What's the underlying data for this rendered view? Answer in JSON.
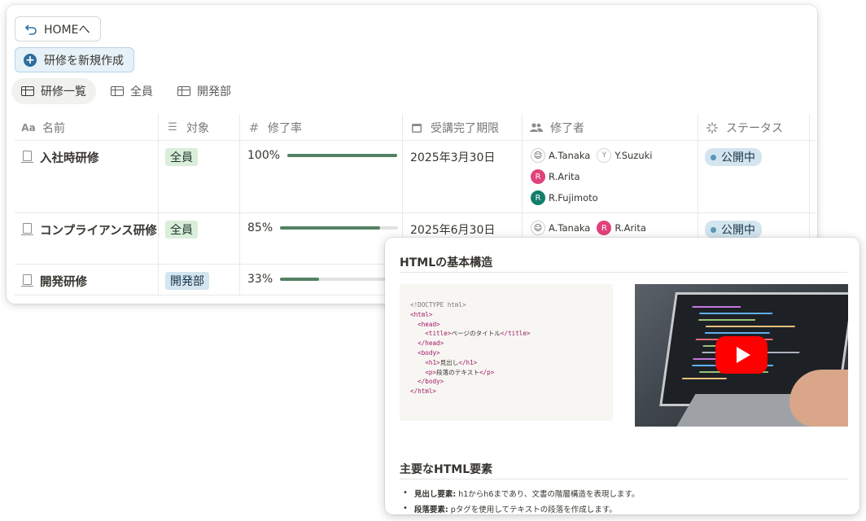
{
  "toolbar": {
    "home_label": "HOMEへ",
    "new_label": "研修を新規作成"
  },
  "views": [
    {
      "label": "研修一覧",
      "active": true
    },
    {
      "label": "全員",
      "active": false
    },
    {
      "label": "開発部",
      "active": false
    }
  ],
  "columns": {
    "name": "名前",
    "target": "対象",
    "rate": "修了率",
    "deadline": "受講完了期限",
    "completers": "修了者",
    "status": "ステータス"
  },
  "rows": [
    {
      "name": "入社時研修",
      "target": "全員",
      "target_color": "green",
      "rate": "100%",
      "rate_value": 1.0,
      "deadline": "2025年3月30日",
      "people": [
        "A.Tanaka",
        "Y.Suzuki",
        "R.Arita",
        "R.Fujimoto"
      ],
      "status": "公開中"
    },
    {
      "name": "コンプライアンス研修",
      "target": "全員",
      "target_color": "green",
      "rate": "85%",
      "rate_value": 0.85,
      "deadline": "2025年6月30日",
      "people": [
        "A.Tanaka",
        "R.Arita"
      ],
      "status": "公開中"
    },
    {
      "name": "開発研修",
      "target": "開発部",
      "target_color": "blue",
      "rate": "33%",
      "rate_value": 0.33,
      "deadline": "",
      "people": [],
      "status": ""
    }
  ],
  "avatars": {
    "y_letter": "Y",
    "r_letter": "R"
  },
  "article": {
    "heading1": "HTMLの基本構造",
    "code": {
      "doctype": "<!DOCTYPE html>",
      "html_open": "<html>",
      "head_open": "<head>",
      "title_open": "<title>",
      "title_text": "ページのタイトル",
      "title_close": "</title>",
      "head_close": "</head>",
      "body_open": "<body>",
      "h1_open": "<h1>",
      "h1_text": "見出し",
      "h1_close": "</h1>",
      "p_open": "<p>",
      "p_text": "段落のテキスト",
      "p_close": "</p>",
      "body_close": "</body>",
      "html_close": "</html>"
    },
    "heading2": "主要なHTML要素",
    "bullets": [
      {
        "term": "見出し要素:",
        "text": " h1からh6まであり、文書の階層構造を表現します。"
      },
      {
        "term": "段落要素:",
        "text": " pタグを使用してテキストの段落を作成します。"
      }
    ]
  }
}
